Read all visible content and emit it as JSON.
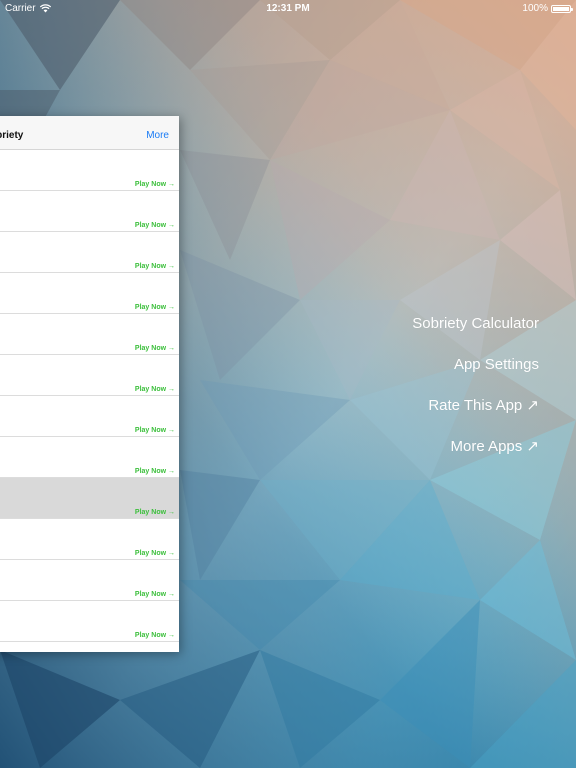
{
  "status_bar": {
    "carrier": "Carrier",
    "time": "12:31 PM",
    "battery": "100%"
  },
  "panel": {
    "title": "obriety",
    "more_label": "More",
    "play_label": "Play Now →",
    "rows": [
      {
        "play": "Play Now →"
      },
      {
        "play": "Play Now →"
      },
      {
        "play": "Play Now →"
      },
      {
        "play": "Play Now →"
      },
      {
        "play": "Play Now →"
      },
      {
        "play": "Play Now →"
      },
      {
        "play": "Play Now →"
      },
      {
        "play": "Play Now →"
      },
      {
        "play": "Play Now →",
        "selected": true
      },
      {
        "play": "Play Now →"
      },
      {
        "play": "Play Now →"
      },
      {
        "play": "Play Now →"
      }
    ]
  },
  "menu": {
    "items": [
      {
        "label": "Sobriety Calculator"
      },
      {
        "label": "App Settings"
      },
      {
        "label": "Rate This App ↗"
      },
      {
        "label": "More Apps ↗"
      }
    ]
  },
  "colors": {
    "play_green": "#3bbf3b",
    "link_blue": "#1b7cf5",
    "selected_row": "#d9d9d9"
  }
}
